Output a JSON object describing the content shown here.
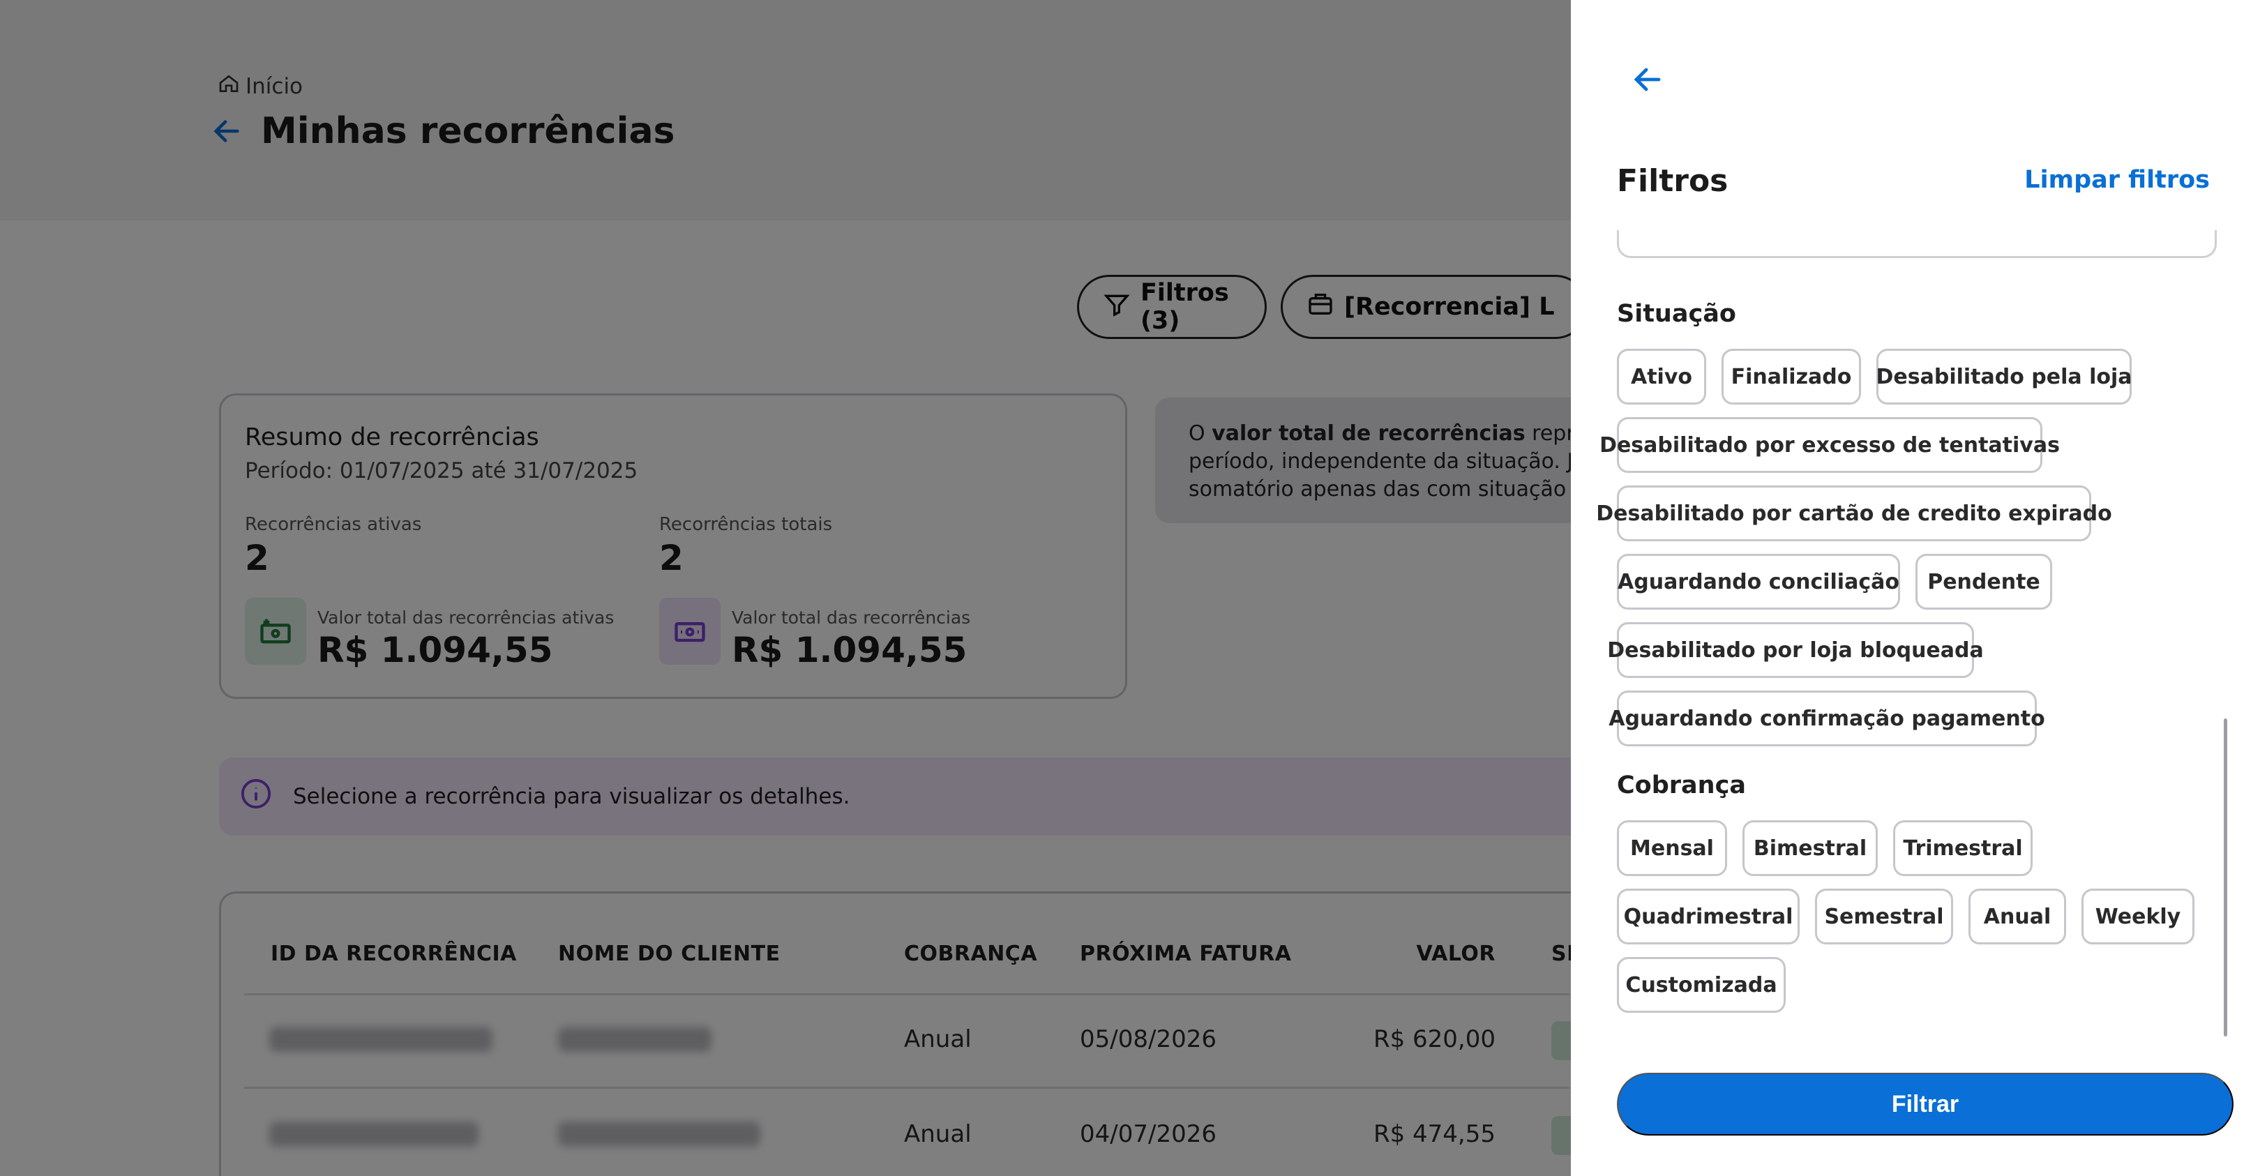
{
  "breadcrumb": {
    "home_label": "Início"
  },
  "page": {
    "title": "Minhas recorrências"
  },
  "toolbar": {
    "filters_label": "Filtros (3)",
    "report_label": "[Recorrencia] L"
  },
  "summary": {
    "title": "Resumo de recorrências",
    "period": "Período: 01/07/2025 até 31/07/2025",
    "active_label": "Recorrências ativas",
    "active_value": "2",
    "total_label": "Recorrências totais",
    "total_value": "2",
    "active_amount_label": "Valor total das recorrências ativas",
    "active_amount": "R$ 1.094,55",
    "total_amount_label": "Valor total das recorrências",
    "total_amount": "R$ 1.094,55"
  },
  "info": {
    "line1_prefix": "O ",
    "line1_bold": "valor total de recorrências",
    "line1_rest": " represen",
    "line2": "período, independente da situação. Já",
    "line3": "somatório apenas das com situação at"
  },
  "notice": {
    "text": "Selecione a recorrência para visualizar os detalhes."
  },
  "table": {
    "headers": {
      "id": "ID DA RECORRÊNCIA",
      "client": "NOME DO CLIENTE",
      "billing": "COBRANÇA",
      "next_invoice": "PRÓXIMA FATURA",
      "value": "VALOR",
      "status": "SI"
    },
    "rows": [
      {
        "billing": "Anual",
        "next_invoice": "05/08/2026",
        "value": "R$ 620,00",
        "status": "A"
      },
      {
        "billing": "Anual",
        "next_invoice": "04/07/2026",
        "value": "R$ 474,55",
        "status": "A"
      }
    ]
  },
  "drawer": {
    "title": "Filtros",
    "clear_label": "Limpar filtros",
    "situacao": {
      "label": "Situação",
      "options": [
        "Ativo",
        "Finalizado",
        "Desabilitado pela loja",
        "Desabilitado por excesso de tentativas",
        "Desabilitado por cartão de credito expirado",
        "Aguardando conciliação",
        "Pendente",
        "Desabilitado por loja bloqueada",
        "Aguardando confirmação pagamento"
      ]
    },
    "cobranca": {
      "label": "Cobrança",
      "options": [
        "Mensal",
        "Bimestral",
        "Trimestral",
        "Quadrimestral",
        "Semestral",
        "Anual",
        "Weekly",
        "Customizada"
      ]
    },
    "submit_label": "Filtrar"
  },
  "colors": {
    "accent": "#0a6fd6",
    "overlay": "rgba(0,0,0,0.5)",
    "notice_bg": "#f1e7fb",
    "active_icon_bg": "#dff1e4",
    "total_icon_bg": "#ece3fb"
  },
  "icons": {
    "home": "home-icon",
    "back": "arrow-left-icon",
    "filter": "filter-icon",
    "report": "briefcase-icon",
    "info": "info-icon",
    "money_active": "money-in-icon",
    "money_total": "money-icon"
  }
}
